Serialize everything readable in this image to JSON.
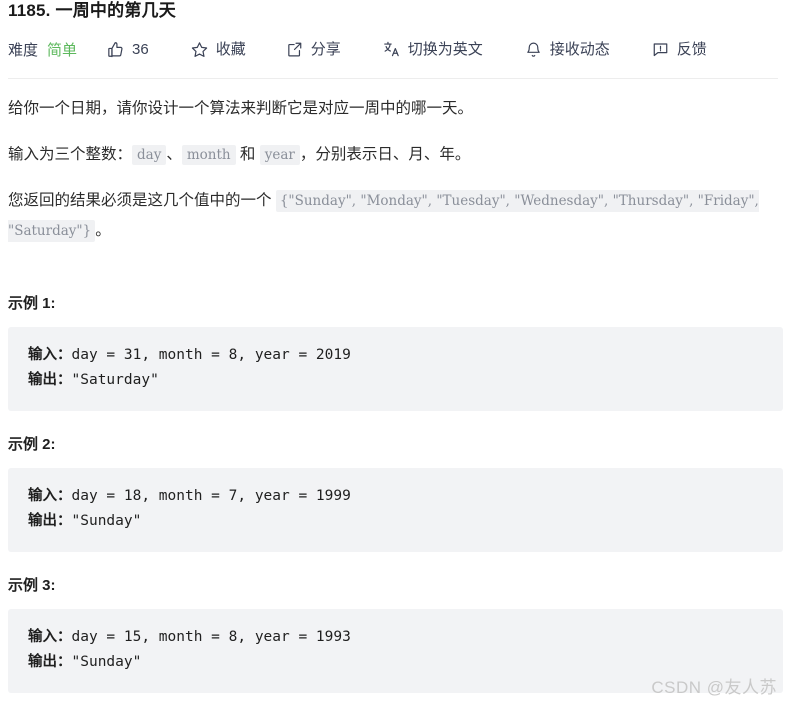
{
  "header": {
    "title_number": "1185.",
    "title_text": " 一周中的第几天",
    "difficulty_label": "难度",
    "difficulty_value": "简单",
    "difficulty_color": "#5cb85c",
    "actions": [
      {
        "icon": "thumbs-up-icon",
        "label": "36",
        "name": "like-button"
      },
      {
        "icon": "star-icon",
        "label": "收藏",
        "name": "favorite-button"
      },
      {
        "icon": "share-icon",
        "label": "分享",
        "name": "share-button"
      },
      {
        "icon": "translate-icon",
        "label": "切换为英文",
        "name": "translate-button"
      },
      {
        "icon": "bell-icon",
        "label": "接收动态",
        "name": "subscribe-button"
      },
      {
        "icon": "feedback-icon",
        "label": "反馈",
        "name": "feedback-button"
      }
    ]
  },
  "description": {
    "p1": "给你一个日期，请你设计一个算法来判断它是对应一周中的哪一天。",
    "p2_before": "输入为三个整数：",
    "p2_code1": "day",
    "p2_sep1": "、",
    "p2_code2": "month",
    "p2_sep2": " 和 ",
    "p2_code3": "year",
    "p2_after": "，分别表示日、月、年。",
    "p3_before": "您返回的结果必须是这几个值中的一个 ",
    "p3_code": "{\"Sunday\", \"Monday\", \"Tuesday\", \"Wednesday\", \"Thursday\", \"Friday\", \"Saturday\"}",
    "p3_after": "。"
  },
  "examples": [
    {
      "heading": "示例 1:",
      "input_label": "输入：",
      "input_value": "day = 31, month = 8, year = 2019",
      "output_label": "输出：",
      "output_value": "\"Saturday\""
    },
    {
      "heading": "示例 2:",
      "input_label": "输入：",
      "input_value": "day = 18, month = 7, year = 1999",
      "output_label": "输出：",
      "output_value": "\"Sunday\""
    },
    {
      "heading": "示例 3:",
      "input_label": "输入：",
      "input_value": "day = 15, month = 8, year = 1993",
      "output_label": "输出：",
      "output_value": "\"Sunday\""
    }
  ],
  "watermark": {
    "text": "CSDN @友人苏"
  }
}
